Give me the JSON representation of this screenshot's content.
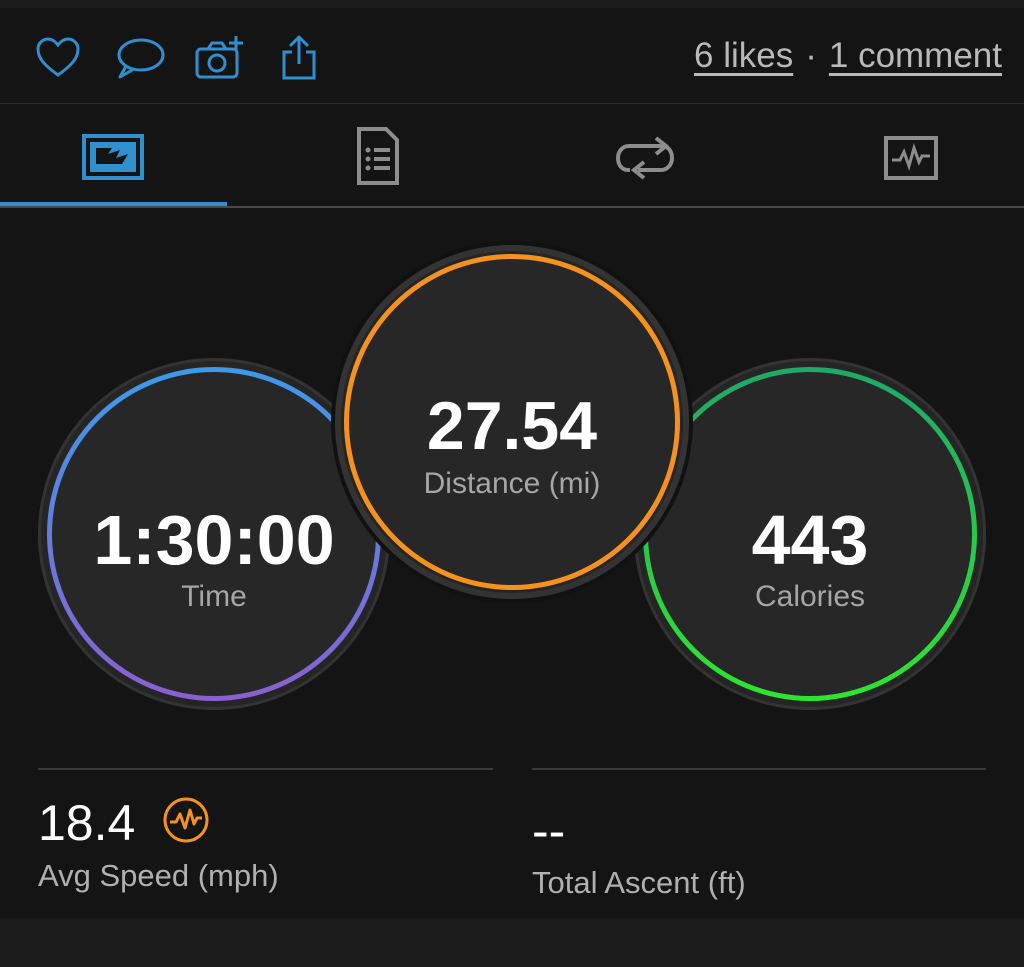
{
  "social": {
    "likes": "6 likes",
    "separator": "·",
    "comments": "1 comment"
  },
  "action_icons": [
    "heart-icon",
    "comment-bubble-icon",
    "add-photo-icon",
    "share-icon"
  ],
  "tabs": [
    {
      "icon": "overview-icon",
      "selected": true
    },
    {
      "icon": "details-list-icon",
      "selected": false
    },
    {
      "icon": "laps-loop-icon",
      "selected": false
    },
    {
      "icon": "activity-chart-icon",
      "selected": false
    }
  ],
  "rings": {
    "time": {
      "value": "1:30:00",
      "label": "Time",
      "colors": [
        "#3d9ae8",
        "#8b5fd0"
      ]
    },
    "distance": {
      "value": "27.54",
      "label": "Distance (mi)",
      "colors": [
        "#f5921e",
        "#f5921e"
      ]
    },
    "calories": {
      "value": "443",
      "label": "Calories",
      "colors": [
        "#1fa86a",
        "#2fe52f"
      ]
    }
  },
  "stats": {
    "avg_speed": {
      "value": "18.4",
      "label": "Avg Speed (mph)",
      "icon": "activity-pulse-icon"
    },
    "total_ascent": {
      "value": "--",
      "label": "Total Ascent (ft)"
    }
  },
  "colors": {
    "accent": "#2f8fcf",
    "background": "#141414",
    "pulse_icon": "#f5921e"
  }
}
